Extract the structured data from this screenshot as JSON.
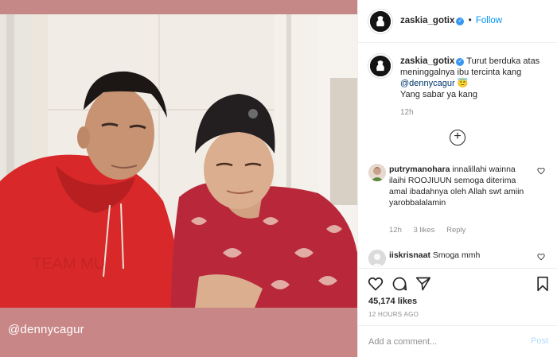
{
  "media": {
    "caption_overlay": "@dennycagur"
  },
  "header": {
    "username": "zaskia_gotix",
    "verified_glyph": "✓",
    "separator": "•",
    "follow_label": "Follow"
  },
  "post": {
    "username": "zaskia_gotix",
    "text_before_mention": "Turut berduka atas meninggalnya ibu tercinta kang",
    "mention": "@dennycagur",
    "emoji": "😇",
    "text_after": "Yang sabar ya kang",
    "time": "12h",
    "load_more_glyph": "+"
  },
  "comments": [
    {
      "username": "putrymanohara",
      "text": "innalillahi wainna ilaihi ROOJIUUN semoga diterima amal ibadahnya oleh Allah swt amiin yarobbalalamin",
      "time": "12h",
      "likes": "3 likes",
      "reply_label": "Reply"
    },
    {
      "username": "iiskrisnaat",
      "text": "Smoga mmh"
    }
  ],
  "actions": {
    "likes": "45,174 likes",
    "ago": "12 HOURS AGO"
  },
  "add_comment": {
    "placeholder": "Add a comment...",
    "post_label": "Post"
  },
  "icons": [
    "heart-icon",
    "comment-icon",
    "share-icon",
    "bookmark-icon",
    "add-circle-icon",
    "verified-badge-icon"
  ],
  "colors": {
    "accent": "#0095f6",
    "caption_band": "#c98686",
    "hoodie": "#d52b2b"
  }
}
